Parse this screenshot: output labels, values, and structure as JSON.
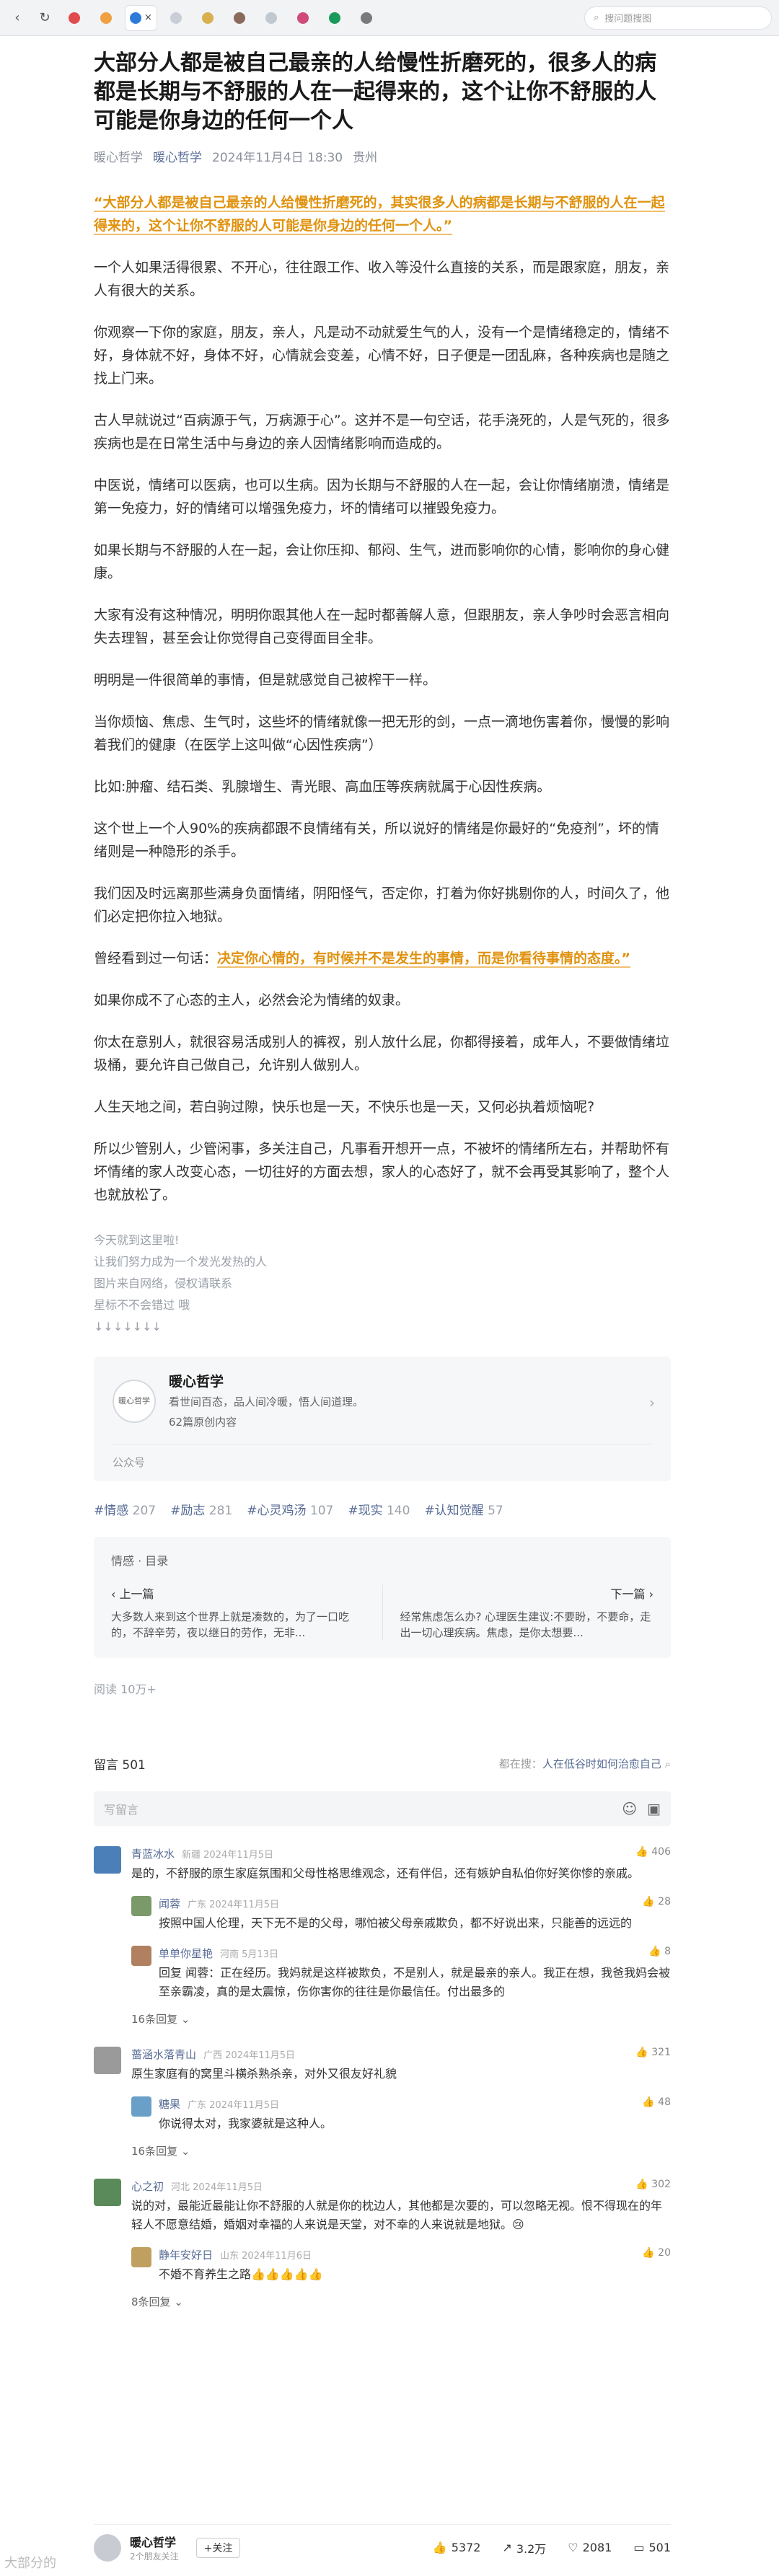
{
  "browser": {
    "tabs": [
      "",
      "",
      "",
      "",
      "",
      "",
      "",
      "",
      "",
      "",
      "",
      "",
      "",
      "",
      "",
      "",
      "",
      "",
      "",
      ""
    ],
    "search_placeholder": "搜问题搜图"
  },
  "article": {
    "title": "大部分人都是被自己最亲的人给慢性折磨死的，很多人的病都是长期与不舒服的人在一起得来的，这个让你不舒服的人可能是你身边的任何一个人",
    "author": "暖心哲学",
    "author_link": "暖心哲学",
    "date": "2024年11月4日 18:30",
    "location": "贵州",
    "lead_quote": "“大部分人都是被自己最亲的人给慢性折磨死的，其实很多人的病都是长期与不舒服的人在一起得来的，这个让你不舒服的人可能是你身边的任何一个人。”",
    "paragraphs": [
      "一个人如果活得很累、不开心，往往跟工作、收入等没什么直接的关系，而是跟家庭，朋友，亲人有很大的关系。",
      "你观察一下你的家庭，朋友，亲人，凡是动不动就爱生气的人，没有一个是情绪稳定的，情绪不好，身体就不好，身体不好，心情就会变差，心情不好，日子便是一团乱麻，各种疾病也是随之找上门来。",
      "古人早就说过“百病源于气，万病源于心”。这并不是一句空话，花手浇死的，人是气死的，很多疾病也是在日常生活中与身边的亲人因情绪影响而造成的。",
      "中医说，情绪可以医病，也可以生病。因为长期与不舒服的人在一起，会让你情绪崩溃，情绪是第一免疫力，好的情绪可以增强免疫力，坏的情绪可以摧毁免疫力。",
      "如果长期与不舒服的人在一起，会让你压抑、郁闷、生气，进而影响你的心情，影响你的身心健康。",
      "大家有没有这种情况，明明你跟其他人在一起时都善解人意，但跟朋友，亲人争吵时会恶言相向失去理智，甚至会让你觉得自己变得面目全非。",
      "明明是一件很简单的事情，但是就感觉自己被榨干一样。",
      "当你烦恼、焦虑、生气时，这些坏的情绪就像一把无形的剑，一点一滴地伤害着你，慢慢的影响着我们的健康（在医学上这叫做“心因性疾病”）",
      "比如:肿瘤、结石类、乳腺增生、青光眼、高血压等疾病就属于心因性疾病。",
      "这个世上一个人90%的疾病都跟不良情绪有关，所以说好的情绪是你最好的“免疫剂”，坏的情绪则是一种隐形的杀手。",
      "我们因及时远离那些满身负面情绪，阴阳怪气，否定你，打着为你好挑剔你的人，时间久了，他们必定把你拉入地狱。"
    ],
    "saying_prefix": "曾经看到过一句话：",
    "saying_quote": "决定你心情的，有时候并不是发生的事情，而是你看待事情的态度。”",
    "paragraphs2": [
      "如果你成不了心态的主人，必然会沦为情绪的奴隶。",
      "你太在意别人，就很容易活成别人的裤衩，别人放什么屁，你都得接着，成年人，不要做情绪垃圾桶，要允许自己做自己，允许别人做别人。",
      "人生天地之间，若白驹过隙，快乐也是一天，不快乐也是一天，又何必执着烦恼呢?",
      "所以少管别人，少管闲事，多关注自己，凡事看开想开一点，不被坏的情绪所左右，并帮助怀有坏情绪的家人改变心态，一切往好的方面去想，家人的心态好了，就不会再受其影响了，整个人也就放松了。"
    ],
    "footer_lines": [
      "今天就到这里啦!",
      "让我们努力成为一个发光发热的人",
      "图片来自网络，侵权请联系",
      "星标不不会错过 哦",
      "↓↓↓↓↓↓↓"
    ]
  },
  "account_card": {
    "avatar_text": "暖心哲学",
    "name": "暖心哲学",
    "desc": "看世间百态，品人间冷暖，悟人间道理。",
    "count": "62篇原创内容",
    "footer": "公众号"
  },
  "tags": [
    {
      "label": "#情感",
      "count": "207"
    },
    {
      "label": "#励志",
      "count": "281"
    },
    {
      "label": "#心灵鸡汤",
      "count": "107"
    },
    {
      "label": "#现实",
      "count": "140"
    },
    {
      "label": "#认知觉醒",
      "count": "57"
    }
  ],
  "collection": {
    "title": "情感 · 目录",
    "prev_label": "‹ 上一篇",
    "prev_text": "大多数人来到这个世界上就是凑数的，为了一口吃的，不辞辛劳，夜以继日的劳作，无非...",
    "next_label": "下一篇 ›",
    "next_text": "经常焦虑怎么办? 心理医生建议:不要盼，不要命，走出一切心理疾病。焦虑，是你太想要..."
  },
  "reads": "阅读 10万+",
  "comments": {
    "title": "留言 501",
    "search_prefix": "都在搜：",
    "search_link": "人在低谷时如何治愈自己",
    "input_placeholder": "写留言",
    "items": [
      {
        "nick": "青蓝冰水",
        "loc": "新疆 2024年11月5日",
        "likes": "406",
        "color": "#4b7fb8",
        "text": "是的，不舒服的原生家庭氛围和父母性格思维观念，还有伴侣，还有嫉妒自私伯你好笑你惨的亲戚。",
        "replies": [
          {
            "nick": "闻蓉",
            "loc": "广东 2024年11月5日",
            "likes": "28",
            "color": "#7a9a6a",
            "text": "按照中国人伦理，天下无不是的父母，哪怕被父母亲戚欺负，都不好说出来，只能善的远远的"
          },
          {
            "nick": "单单你星艳",
            "loc": "河南 5月13日",
            "likes": "8",
            "color": "#b08060",
            "text": "回复 闻蓉：正在经历。我妈就是这样被欺负，不是别人，就是最亲的亲人。我正在想，我爸我妈会被至亲霸凌，真的是太震惊，伤你害你的往往是你最信任。付出最多的"
          }
        ],
        "more": "16条回复 ⌄"
      },
      {
        "nick": "蔷涵水落青山",
        "loc": "广西 2024年11月5日",
        "likes": "321",
        "color": "#9a9a9a",
        "text": "原生家庭有的窝里斗横杀熟杀亲，对外又很友好礼貌",
        "replies": [
          {
            "nick": "糖果",
            "loc": "广东 2024年11月5日",
            "likes": "48",
            "color": "#6aa0c8",
            "text": "你说得太对，我家婆就是这种人。"
          }
        ],
        "more": "16条回复 ⌄"
      },
      {
        "nick": "心之初",
        "loc": "河北 2024年11月5日",
        "likes": "302",
        "color": "#5a8a5a",
        "text": "说的对，最能近最能让你不舒服的人就是你的枕边人，其他都是次要的，可以忽略无视。恨不得现在的年轻人不愿意结婚，婚姻对幸福的人来说是天堂，对不幸的人来说就是地狱。😢",
        "replies": [
          {
            "nick": "静年安好日",
            "loc": "山东 2024年11月6日",
            "likes": "20",
            "color": "#c0a060",
            "text": "不婚不育养生之路👍👍👍👍👍"
          }
        ],
        "more": "8条回复 ⌄"
      }
    ]
  },
  "bottom_bar": {
    "name": "暖心哲学",
    "sub": "2个朋友关注",
    "follow": "+关注",
    "likes": "5372",
    "shares": "3.2万",
    "favs": "2081",
    "comments": "501"
  },
  "watermark": "大部分的"
}
